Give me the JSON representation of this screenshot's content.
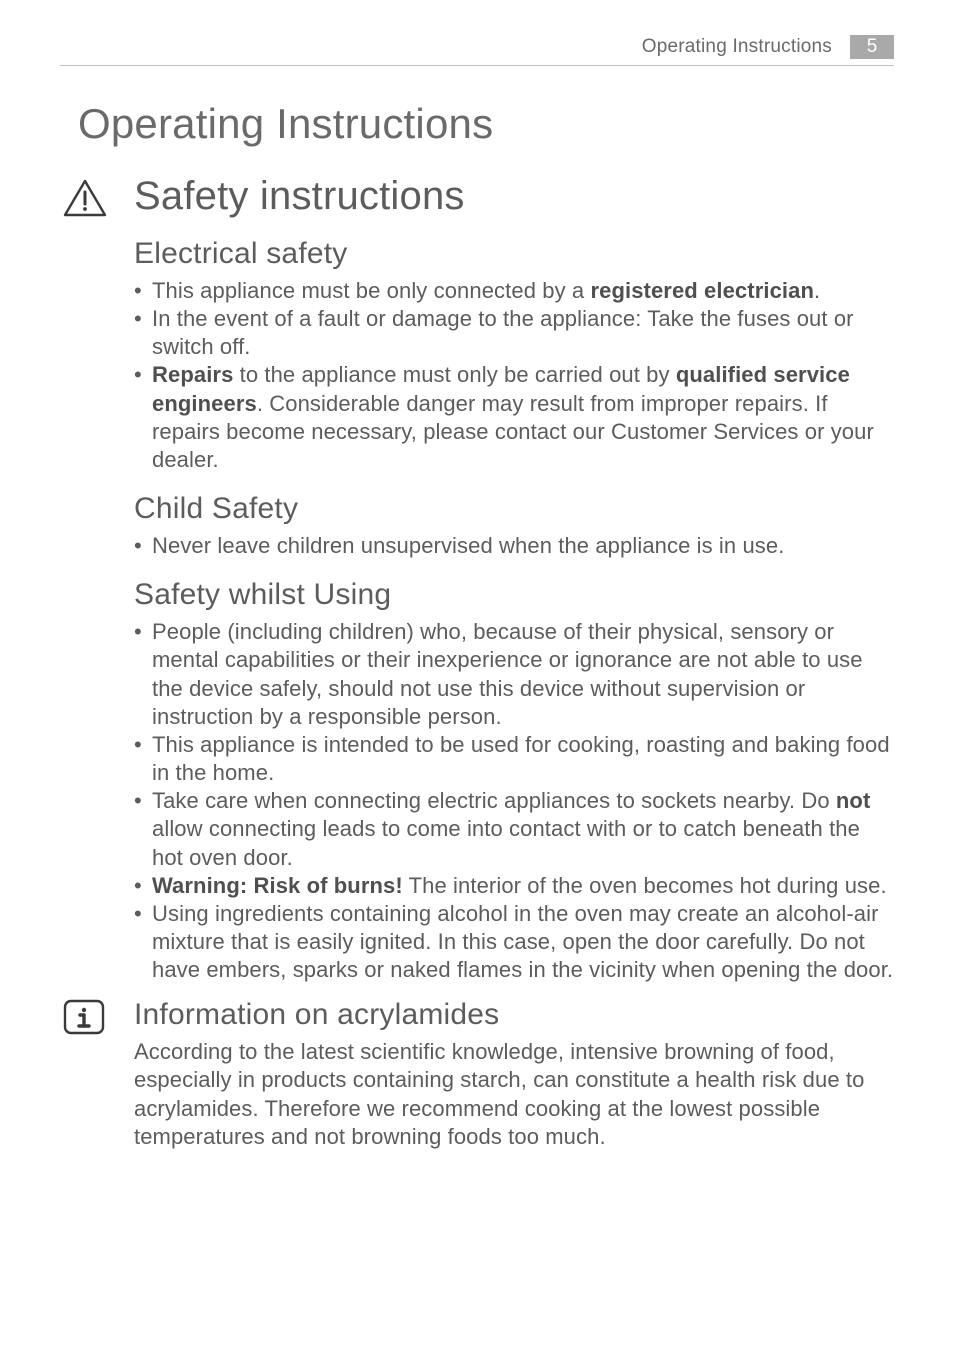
{
  "header": {
    "running_title": "Operating Instructions",
    "page_number": "5"
  },
  "title": "Operating Instructions",
  "safety": {
    "heading": "Safety instructions",
    "electrical": {
      "heading": "Electrical safety",
      "items": [
        {
          "pre": "This appliance must be only connected by a ",
          "b1": "registered electrician",
          "post": "."
        },
        {
          "full": "In the event of a fault or damage to the appliance: Take the fuses out or switch off."
        },
        {
          "b1": "Repairs",
          "mid": " to the appliance must only be carried out by ",
          "b2": "qualified service engineers",
          "post": ". Considerable danger may result from improper repairs. If repairs become necessary, please contact our Customer Services or your dealer."
        }
      ]
    },
    "child": {
      "heading": "Child Safety",
      "items": [
        {
          "full": "Never leave children unsupervised when the appliance is in use."
        }
      ]
    },
    "using": {
      "heading": "Safety whilst Using",
      "items": [
        {
          "full": "People (including children) who, because of their physical, sensory or mental capabilities or their inexperience or ignorance are not able to use the device safely, should not use this device without supervision or instruction by a responsible person."
        },
        {
          "full": "This appliance is intended to be used for cooking, roasting and baking food in the home."
        },
        {
          "pre": "Take care when connecting electric appliances to sockets nearby. Do ",
          "b1": "not",
          "post": " allow connecting leads to come into contact with or to catch beneath the hot oven door."
        },
        {
          "b1": "Warning: Risk of burns!",
          "post": " The interior of the oven becomes hot during use."
        },
        {
          "full": "Using ingredients containing alcohol in the oven may create an alcohol-air mixture that is easily ignited. In this case, open the door carefully. Do not have embers, sparks or naked flames in the vicinity when opening the door."
        }
      ]
    }
  },
  "acrylamides": {
    "heading": "Information on acrylamides",
    "paragraph": "According to the latest scientific knowledge, intensive browning of food, especially in products containing starch, can constitute a health risk due to acrylamides. Therefore we recommend cooking at the lowest possible temperatures and not browning foods too much."
  }
}
